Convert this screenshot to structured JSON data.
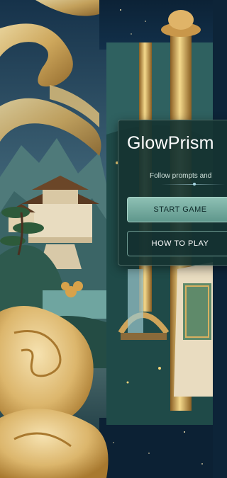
{
  "game": {
    "title": "GlowPrism",
    "subtitle": "Follow prompts and",
    "buttons": {
      "start": "START GAME",
      "how_to_play": "HOW TO PLAY"
    }
  },
  "colors": {
    "sky": "#0d2438",
    "gold": "#d9b46a",
    "panel": "#163432",
    "accent": "#8ec0b4"
  }
}
